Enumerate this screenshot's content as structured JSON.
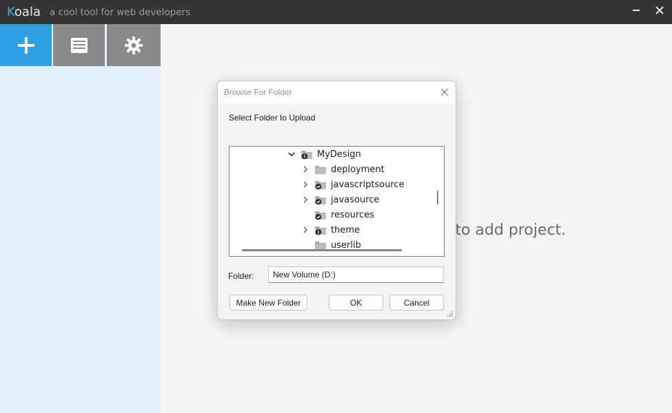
{
  "app": {
    "name_first": "K",
    "name_rest": "oala",
    "tagline": "a cool tool for web developers"
  },
  "toolbar": {
    "buttons": [
      {
        "name": "add-project",
        "icon": "plus-icon",
        "active": true
      },
      {
        "name": "log",
        "icon": "log-icon",
        "active": false
      },
      {
        "name": "settings",
        "icon": "gear-icon",
        "active": false
      }
    ]
  },
  "main": {
    "hint": "Drop folder here to add project."
  },
  "dialog": {
    "title": "Browse For Folder",
    "prompt": "Select Folder to Upload",
    "tree": [
      {
        "label": "MyDesign",
        "expanded": true,
        "has_children": true,
        "badge": "info"
      },
      {
        "label": "deployment",
        "expanded": false,
        "has_children": true,
        "badge": "none"
      },
      {
        "label": "javascriptsource",
        "expanded": false,
        "has_children": true,
        "badge": "check"
      },
      {
        "label": "javasource",
        "expanded": false,
        "has_children": true,
        "badge": "check"
      },
      {
        "label": "resources",
        "expanded": false,
        "has_children": false,
        "badge": "check"
      },
      {
        "label": "theme",
        "expanded": false,
        "has_children": true,
        "badge": "info"
      },
      {
        "label": "userlib",
        "expanded": false,
        "has_children": false,
        "badge": "none"
      }
    ],
    "folder_label": "Folder:",
    "folder_value": "New Volume (D:)",
    "buttons": {
      "make_new_folder": "Make New Folder",
      "ok": "OK",
      "cancel": "Cancel"
    }
  },
  "colors": {
    "accent": "#2d9ee0",
    "titlebar": "#353535",
    "sidebar": "#e4f1fa",
    "folder": "#a8a8a8"
  }
}
